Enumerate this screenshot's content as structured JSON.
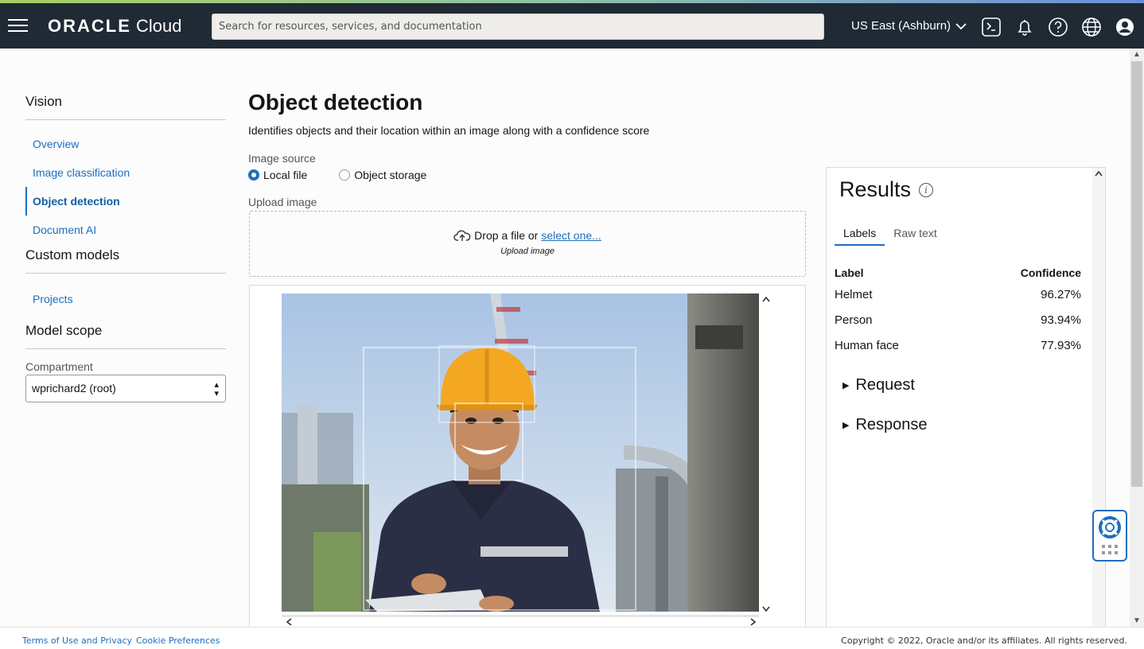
{
  "colors": {
    "topbar": "#1f2a35",
    "link": "#1e6ec0",
    "accent_gradient": [
      "#a8cf63",
      "#6a8fd9"
    ]
  },
  "header": {
    "brand_bold": "ORACLE",
    "brand_light": " Cloud",
    "search_placeholder": "Search for resources, services, and documentation",
    "region": "US East (Ashburn)",
    "icons": [
      "menu-icon",
      "cloud-shell-icon",
      "bell-icon",
      "help-icon",
      "globe-icon",
      "user-icon"
    ]
  },
  "sidebar": {
    "section1_title": "Vision",
    "items": [
      {
        "label": "Overview"
      },
      {
        "label": "Image classification"
      },
      {
        "label": "Object detection",
        "active": true
      },
      {
        "label": "Document AI"
      }
    ],
    "section2_title": "Custom models",
    "items2": [
      {
        "label": "Projects"
      }
    ],
    "section3_title": "Model scope",
    "compartment_label": "Compartment",
    "compartment_value": "wprichard2 (root)"
  },
  "main": {
    "title": "Object detection",
    "description": "Identifies objects and their location within an image along with a confidence score",
    "image_source_label": "Image source",
    "radio_local": "Local file",
    "radio_storage": "Object storage",
    "selected_source": "Local file",
    "upload_label": "Upload image",
    "drop_text": "Drop a file or",
    "drop_link": "select one...",
    "drop_sub": "Upload image"
  },
  "results": {
    "title": "Results",
    "tabs": [
      "Labels",
      "Raw text"
    ],
    "active_tab": "Labels",
    "col_label": "Label",
    "col_confidence": "Confidence",
    "rows": [
      {
        "label": "Helmet",
        "confidence": "96.27%"
      },
      {
        "label": "Person",
        "confidence": "93.94%"
      },
      {
        "label": "Human face",
        "confidence": "77.93%"
      }
    ],
    "request": "Request",
    "response": "Response"
  },
  "footer": {
    "terms": "Terms of Use and Privacy",
    "cookies": "Cookie Preferences",
    "copyright": "Copyright © 2022, Oracle and/or its affiliates. All rights reserved."
  }
}
